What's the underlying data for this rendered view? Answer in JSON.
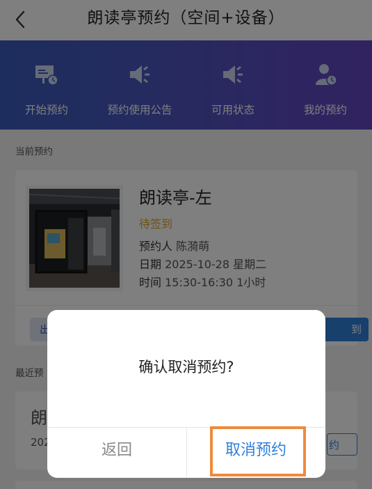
{
  "header": {
    "title": "朗读亭预约（空间+设备）"
  },
  "nav": [
    {
      "label": "开始预约",
      "icon": "presentation-board-icon"
    },
    {
      "label": "预约使用公告",
      "icon": "speaker-icon"
    },
    {
      "label": "可用状态",
      "icon": "speaker-icon"
    },
    {
      "label": "我的预约",
      "icon": "user-clock-icon"
    }
  ],
  "current": {
    "section_label": "当前预约",
    "venue": "朗读亭-左",
    "status": "待签到",
    "booker_key": "预约人",
    "booker": "陈漪萌",
    "date_key": "日期",
    "date": "2025-10-28 星期二",
    "time_key": "时间",
    "time": "15:30-16:30 1小时",
    "left_button_partial": "出",
    "right_button_partial": "到"
  },
  "recent": {
    "section_label_partial": "最近预",
    "venue_partial": "朗",
    "date_partial": "202",
    "button_partial": "约"
  },
  "dialog": {
    "message": "确认取消预约?",
    "back_label": "返回",
    "confirm_label": "取消预约"
  },
  "colors": {
    "accent": "#2f80d8",
    "status_pending": "#d9a431",
    "highlight": "#ef8a3c"
  }
}
